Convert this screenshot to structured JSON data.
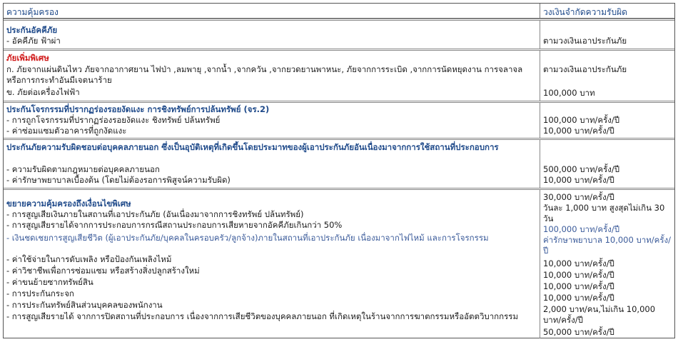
{
  "header": {
    "coverage": "ความคุ้มครอง",
    "limit": "วงเงินจำกัดความรับผิด"
  },
  "s1": {
    "title": "ประกันอัคคีภัย",
    "items": [
      "- อัคคีภัย ฟ้าผ่า"
    ],
    "values": [
      "ตามวงเงินเอาประกันภัย"
    ]
  },
  "s2": {
    "title": "ภัยเพิ่มพิเศษ",
    "items": [
      "ก. ภัยจากแผ่นดินไหว ภัยจากอากาศยาน ไฟป่า ,ลมพายุ ,จากน้ำ ,จากควัน ,จากยวดยานพาหนะ, ภัยจากการระเบิด ,จากการนัดหยุดงาน การจลาจล หรือการกระทำอันมีเจตนาร้าย",
      "ข. ภัยต่อเครื่องไฟฟ้า"
    ],
    "values": [
      "ตามวงเงินเอาประกันภัย",
      "100,000 บาท"
    ]
  },
  "s3": {
    "title": "ประกันโจรกรรมที่ปรากฏร่องรอยงัดแงะ การชิงทรัพย์การปล้นทรัพย์ (จร.2)",
    "items": [
      "- การถูกโจรกรรมที่ปรากฏร่องรอยงัดแงะ ชิงทรัพย์ ปล้นทรัพย์",
      "- ค่าซ่อมแซมตัวอาคารที่ถูกงัดแงะ"
    ],
    "values": [
      "100,000 บาท/ครั้ง/ปี",
      "10,000 บาท/ครั้ง/ปี"
    ]
  },
  "s4": {
    "title": "ประกันภัยความรับผิดชอบต่อบุคคลภายนอก ซึ่งเป็นอุบัติเหตุที่เกิดขึ้นโดยประมาทของผู้เอาประกันภัยอันเนื่องมาจากการใช้สถานที่ประกอบการ",
    "items": [
      "- ความรับผิดตามกฎหมายต่อบุคคลภายนอก",
      "- ค่ารักษาพยาบาลเบื้องต้น (โดยไม่ต้องรอการพิสูจน์ความรับผิด)"
    ],
    "values": [
      "500,000 บาท/ครั้ง/ปี",
      "10,000 บาท/ครั้ง/ปี"
    ]
  },
  "s5": {
    "title": "ขยายความคุ้มครองถึงเงื่อนไขพิเศษ",
    "items": [
      "- การสูญเสียเงินภายในสถานที่เอาประกันภัย (อันเนื่องมาจากการชิงทรัพย์ ปล้นทรัพย์)",
      "- การสูญเสียรายได้จากการประกอบการกรณีสถานประกอบการเสียหายจากอัคคีภัยเกินกว่า 50%",
      "- เงินชดเชยการสูญเสียชีวิต (ผู้เอาประกันภัย/บุคคลในครอบครัว/ลูกจ้าง)ภายในสถานที่เอาประกันภัย เนื่องมาจากไฟไหม้ และการโจรกรรม",
      "- ค่าใช้จ่ายในการดับเพลิง หรือป้องกันเพลิงไหม้",
      "- ค่าวิชาชีพเพื่อการซ่อมแซม หรือสร้างสิ่งปลูกสร้างใหม่",
      "- ค่าขนย้ายซากทรัพย์สิน",
      "- การประกันกระจก",
      "- การประกันทรัพย์สินส่วนบุคคลของพนักงาน",
      "- การสูญเสียรายได้ จากการปิดสถานที่ประกอบการ เนื่องจากการเสียชีวิตของบุคคลภายนอก ที่เกิดเหตุในร้านจากการฆาตกรรมหรืออัตตวิบากกรรม"
    ],
    "values": [
      "30,000 บาท/ครั้ง/ปี",
      "วันละ 1,000 บาท สูงสุดไม่เกิน 30 วัน",
      "100,000 บาท/ครั้ง/ปี",
      "ค่ารักษาพยาบาล 10,000 บาท/ครั้ง/ปี",
      "10,000 บาท/ครั้ง/ปี",
      "10,000 บาท/ครั้ง/ปี",
      "10,000 บาท/ครั้ง/ปี",
      "10,000 บาท/ครั้ง/ปี",
      "2,000 บาท/คน,ไม่เกิน 10,000 บาท/ครั้ง/ปี",
      "50,000 บาท/ครั้ง/ปี"
    ]
  }
}
